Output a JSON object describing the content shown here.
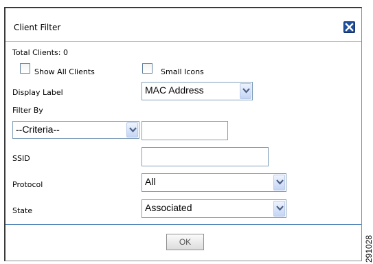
{
  "dialog": {
    "title": "Client Filter",
    "close_icon": "close-icon"
  },
  "summary": {
    "total_clients_label": "Total Clients: 0"
  },
  "options": {
    "show_all_clients_label": "Show All Clients",
    "show_all_clients_checked": false,
    "small_icons_label": "Small Icons",
    "small_icons_checked": false
  },
  "display_label": {
    "label": "Display Label",
    "selected": "MAC Address"
  },
  "filter": {
    "label": "Filter By",
    "criteria_selected": "--Criteria--",
    "criteria_value": ""
  },
  "ssid": {
    "label": "SSID",
    "value": ""
  },
  "protocol": {
    "label": "Protocol",
    "selected": "All"
  },
  "state": {
    "label": "State",
    "selected": "Associated"
  },
  "footer": {
    "ok_label": "OK"
  },
  "figure_id": "291028"
}
